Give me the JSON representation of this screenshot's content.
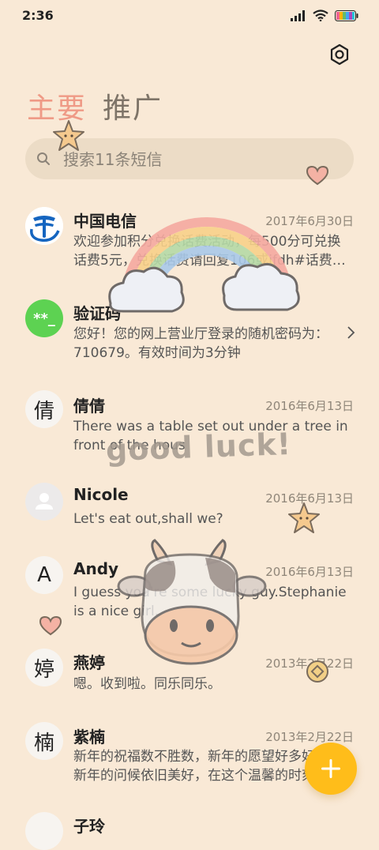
{
  "status_bar": {
    "time": "2:36"
  },
  "tabs": [
    {
      "label": "主要",
      "active": true
    },
    {
      "label": "推广",
      "active": false
    }
  ],
  "search": {
    "placeholder": "搜索11条短信"
  },
  "decorations": {
    "sticker_text": "good luck!"
  },
  "conversations": [
    {
      "name": "中国电信",
      "date": "2017年6月30日",
      "preview": "欢迎参加积分兑换话费活动，每500分可兑换话费5元，兑换话费请回复106或jfdh#话费…",
      "avatar": "telecom-logo-icon"
    },
    {
      "name": "验证码",
      "date": "",
      "preview": "您好！您的网上营业厅登录的随机密码为：710679。有效时间为3分钟",
      "avatar_text": "**_",
      "avatar_color": "#5dd252"
    },
    {
      "name": "倩倩",
      "date": "2016年6月13日",
      "preview": "There was a table set out under a tree in front of the hous",
      "avatar_text": "倩"
    },
    {
      "name": "Nicole",
      "date": "2016年6月13日",
      "preview": "Let's eat out,shall we?",
      "avatar": "person-icon"
    },
    {
      "name": "Andy",
      "date": "2016年6月13日",
      "preview": "I guess you're some lucky guy.Stephanie is a nice girl.",
      "avatar_text": "A"
    },
    {
      "name": "燕婷",
      "date": "2013年2月22日",
      "preview": "嗯。收到啦。同乐同乐。",
      "avatar_text": "婷"
    },
    {
      "name": "紫楠",
      "date": "2013年2月22日",
      "preview": "新年的祝福数不胜数，新年的愿望好多好多，新年的问候依旧美好，在这个温馨的时刻",
      "avatar_text": "楠"
    },
    {
      "name": "子玲",
      "date": "",
      "preview": "",
      "avatar_text": ""
    }
  ],
  "colors": {
    "background": "#f9e9d6",
    "active_tab": "#ef9a86",
    "fab": "#ffbd1a",
    "verification_avatar": "#5dd252",
    "telecom_blue": "#1565c0"
  }
}
